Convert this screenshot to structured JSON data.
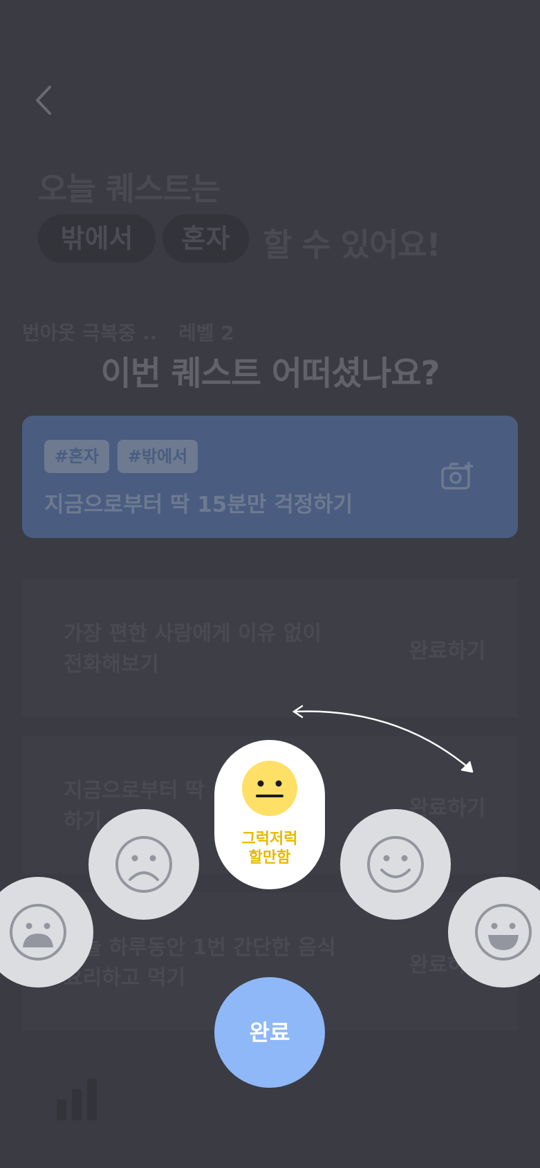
{
  "header": {
    "back_icon": "chevron-left-icon"
  },
  "hero": {
    "line1": "오늘 퀘스트는",
    "chip_outside": "밖에서",
    "chip_alone": "혼자",
    "line2_suffix": "할 수 있어요!"
  },
  "status": {
    "label": "번아웃 극복중 ..",
    "level": "레벨 2"
  },
  "dialog": {
    "question": "이번 퀘스트 어떠셨나요?",
    "current_quest": {
      "tags": [
        "#혼자",
        "#밖에서"
      ],
      "title": "지금으로부터 딱 15분만 걱정하기",
      "camera_icon": "camera-plus-icon"
    },
    "emotions": [
      {
        "name": "very-bad",
        "icon": "frown-open-icon"
      },
      {
        "name": "bad",
        "icon": "frown-icon"
      },
      {
        "name": "neutral",
        "icon": "neutral-face-icon",
        "label_line1": "그럭저럭",
        "label_line2": "할만함",
        "selected": true
      },
      {
        "name": "good",
        "icon": "smile-icon"
      },
      {
        "name": "very-good",
        "icon": "grin-icon"
      }
    ],
    "swipe_hint_icon": "curved-double-arrow-icon",
    "done_label": "완료"
  },
  "quest_list": [
    {
      "line1": "가장 편한 사람에게 이유 없이",
      "line2": "전화해보기",
      "action": "완료하기"
    },
    {
      "line1": "지금으로부터 딱 1",
      "line2": "하기",
      "action": "완료하기"
    },
    {
      "line1": "오늘 하루동안 1번 간단한 음식",
      "line2": "요리하고 먹기",
      "action": "완료하"
    }
  ],
  "bottom_nav": {
    "stats_icon": "bar-chart-icon"
  },
  "colors": {
    "background": "#3b3b43",
    "card": "#4a5d80",
    "accent_yellow": "#ffe066",
    "label_yellow": "#e6b800",
    "done_button": "#8eb8f8",
    "emoji_bg": "#dcdde1"
  }
}
